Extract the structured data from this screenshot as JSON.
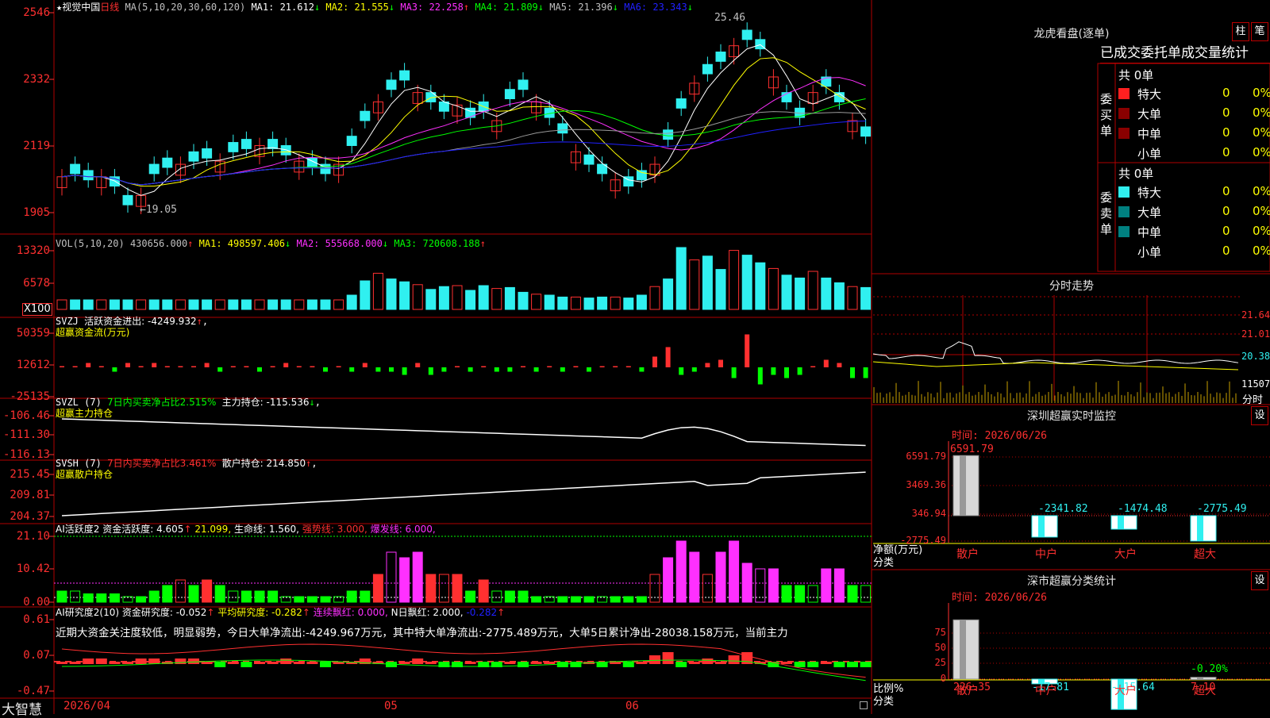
{
  "colors": {
    "up": "#ff3030",
    "down": "#30f0f0",
    "frame": "#b00000",
    "yellow": "#ffff00",
    "magenta": "#ff30ff",
    "green": "#00ff00",
    "white": "#ffffff",
    "blue": "#2020ff"
  },
  "main": {
    "star": "★",
    "stock_name": "视觉中国",
    "period": "日线",
    "ma_label": "MA(5,10,20,30,60,120)",
    "ma_items": [
      {
        "text": "MA1: 21.612",
        "arrow": "↓",
        "color": "#ffffff"
      },
      {
        "text": "MA2: 21.555",
        "arrow": "↓",
        "color": "#ffff00"
      },
      {
        "text": "MA3: 22.258",
        "arrow": "↑",
        "color": "#ff30ff"
      },
      {
        "text": "MA4: 21.809",
        "arrow": "↓",
        "color": "#00ff00"
      },
      {
        "text": "MA5: 21.396",
        "arrow": "↓",
        "color": "#c0c0c0"
      },
      {
        "text": "MA6: 23.343",
        "arrow": "↓",
        "color": "#2020ff"
      }
    ],
    "yaxis": [
      "2546",
      "2332",
      "2119",
      "1905"
    ],
    "high_label": "25.46",
    "low_label": "←19.05"
  },
  "vol": {
    "label": "VOL(5,10,20)",
    "items": [
      {
        "text": "430656.000",
        "arrow": "↑",
        "color": "#c0c0c0"
      },
      {
        "text": "MA1: 498597.406",
        "arrow": "↓",
        "color": "#ffff00"
      },
      {
        "text": "MA2: 555668.000",
        "arrow": "↓",
        "color": "#ff30ff"
      },
      {
        "text": "MA3: 720608.188",
        "arrow": "↑",
        "color": "#00ff00"
      }
    ],
    "yaxis": [
      "13320",
      "6578"
    ],
    "unit": "X100"
  },
  "svzj": {
    "label": "SVZJ",
    "text": "活跃资金进出: -4249.932",
    "arrow": "↑",
    "suffix": ",",
    "sub": "超赢资金流(万元)",
    "yaxis": [
      "50359",
      "12612",
      "-25135"
    ]
  },
  "svzl": {
    "label": "SVZL (7)",
    "text1": "7日内买卖净占比2.515%",
    "text2": "主力持仓: -115.536",
    "arrow": "↓",
    "suffix": ",",
    "sub": "超赢主力持仓",
    "yaxis": [
      "-106.46",
      "-111.30",
      "-116.13"
    ]
  },
  "svsh": {
    "label": "SVSH (7)",
    "text1": "7日内买卖净占比3.461%",
    "text2": "散户持仓: 214.850",
    "arrow": "↑",
    "suffix": ",",
    "sub": "超赢散户持仓",
    "yaxis": [
      "215.45",
      "209.81",
      "204.37"
    ]
  },
  "ai2": {
    "label": "AI活跃度2",
    "items": [
      {
        "text": "资金活跃度: 4.605",
        "arrow": "↑",
        "color": "#ffffff"
      },
      {
        "text": "21.099,",
        "arrow": "",
        "color": "#ffff00"
      },
      {
        "text": "生命线: 1.560,",
        "arrow": "",
        "color": "#ffffff"
      },
      {
        "text": "强势线: 3.000,",
        "arrow": "",
        "color": "#ff3030"
      },
      {
        "text": "爆发线: 6.000,",
        "arrow": "",
        "color": "#ff30ff"
      }
    ],
    "yaxis": [
      "21.10",
      "10.42",
      "0.00"
    ]
  },
  "ai_res": {
    "label": "AI研究度2(10)",
    "items": [
      {
        "text": "资金研究度: -0.052",
        "arrow": "↑",
        "color": "#ffffff"
      },
      {
        "text": "平均研究度: -0.282",
        "arrow": "↑",
        "color": "#ffff00"
      },
      {
        "text": "连续飘红: 0.000,",
        "arrow": "",
        "color": "#ff30ff"
      },
      {
        "text": "N日飘红: 2.000,",
        "arrow": "",
        "color": "#ffffff"
      },
      {
        "text": "-0.282",
        "arrow": "↑",
        "color": "#2020ff"
      }
    ],
    "commentary": "近期大资金关注度较低，明显弱势，今日大单净流出:-4249.967万元，其中特大单净流出:-2775.489万元，大单5日累计净出-28038.158万元，当前主力",
    "yaxis": [
      "0.61",
      "0.07",
      "-0.47"
    ]
  },
  "xaxis": {
    "dates": [
      "2026/04",
      "05",
      "06"
    ]
  },
  "brand": "大智慧",
  "lhb": {
    "title": "龙虎看盘(逐单)",
    "btn_zhu": "柱",
    "btn_bi": "笔",
    "tabs": [
      "已成交",
      "委托单",
      "成交量统计"
    ],
    "buy": {
      "side": "委买单",
      "total": "共 0单",
      "rows": [
        {
          "name": "特大",
          "v": "0",
          "p": "0%",
          "c": "#ff2020"
        },
        {
          "name": "大单",
          "v": "0",
          "p": "0%",
          "c": "#8a0000"
        },
        {
          "name": "中单",
          "v": "0",
          "p": "0%",
          "c": "#8a0000"
        },
        {
          "name": "小单",
          "v": "0",
          "p": "0%",
          "c": ""
        }
      ]
    },
    "sell": {
      "side": "委卖单",
      "total": "共 0单",
      "rows": [
        {
          "name": "特大",
          "v": "0",
          "p": "0%",
          "c": "#30f0f0"
        },
        {
          "name": "大单",
          "v": "0",
          "p": "0%",
          "c": "#008080"
        },
        {
          "name": "中单",
          "v": "0",
          "p": "0%",
          "c": "#008080"
        },
        {
          "name": "小单",
          "v": "0",
          "p": "0%",
          "c": ""
        }
      ]
    }
  },
  "fenshi": {
    "title": "分时走势",
    "yaxis": [
      "21.64",
      "21.01",
      "20.38",
      "11507"
    ],
    "unit": "分时"
  },
  "sz_monitor": {
    "title": "深圳超赢实时监控",
    "btn": "设",
    "time": "时间: 2026/06/26",
    "ylabel": "净额(万元)",
    "xlabel": "分类",
    "yaxis": [
      "6591.79",
      "3469.36",
      "346.94",
      "-2775.49"
    ],
    "categories": [
      "散户",
      "中户",
      "大户",
      "超大"
    ],
    "values": [
      6591.79,
      -2341.82,
      -1474.48,
      -2775.49
    ],
    "labels": [
      "6591.79",
      "-2341.82",
      "-1474.48",
      "-2775.49"
    ]
  },
  "sz_stats": {
    "title": "深市超赢分类统计",
    "btn": "设",
    "time": "时间: 2026/06/26",
    "ylabel": "比例%",
    "xlabel": "分类",
    "yaxis": [
      "75",
      "50",
      "25",
      "0"
    ],
    "categories": [
      "散户",
      "中户",
      "大户",
      "超大"
    ],
    "values": [
      226.35,
      -17.81,
      -115.64,
      7.1
    ],
    "labels": [
      "226.35",
      "-17.81",
      "-115.64",
      "7.10"
    ],
    "extra_label": "-0.20%"
  }
}
